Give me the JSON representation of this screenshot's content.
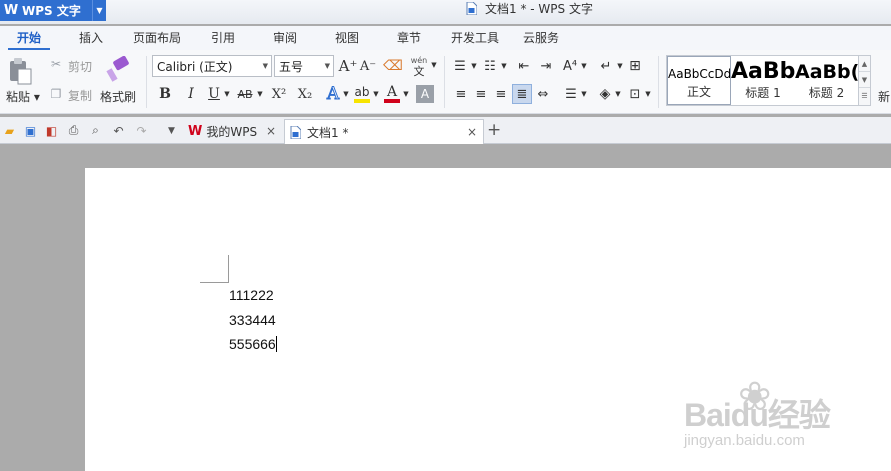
{
  "app": {
    "name": "WPS 文字",
    "logo_letter": "W"
  },
  "window": {
    "title": "文档1 * - WPS 文字"
  },
  "menu": {
    "tabs": [
      "开始",
      "插入",
      "页面布局",
      "引用",
      "审阅",
      "视图",
      "章节",
      "开发工具",
      "云服务"
    ],
    "active_tab": "开始"
  },
  "ribbon": {
    "paste": "粘贴",
    "cut": "剪切",
    "copy": "复制",
    "format_painter": "格式刷",
    "font_name": "Calibri (正文)",
    "font_size": "五号",
    "grow_font": "A⁺",
    "shrink_font": "A⁻",
    "pinyin_top": "wén",
    "pinyin_char": "文",
    "bold": "B",
    "italic": "I",
    "underline": "U",
    "strikethrough": "AB",
    "superscript": "X²",
    "subscript": "X₂",
    "font_effect": "A",
    "highlight": "ab",
    "font_color": "A",
    "char_shading": "A",
    "colors": {
      "highlight": "#f7e400",
      "font_color": "#d0021b",
      "accent": "#2f6fd0"
    }
  },
  "styles": {
    "items": [
      {
        "sample": "AaBbCcDd",
        "name": "正文"
      },
      {
        "sample": "AaBb",
        "name": "标题 1"
      },
      {
        "sample": "AaBb(",
        "name": "标题 2"
      }
    ],
    "more_label": "新"
  },
  "quick_access": {
    "icons": [
      "open-folder-icon",
      "save-icon",
      "export-pdf-icon",
      "print-icon",
      "print-preview-icon",
      "undo-icon",
      "redo-icon",
      "dropdown-icon"
    ]
  },
  "doc_tabs": [
    {
      "label": "我的WPS",
      "icon": "W",
      "active": false
    },
    {
      "label": "文档1 *",
      "active": true
    }
  ],
  "document": {
    "lines": [
      "111222",
      "333444",
      "555666"
    ]
  },
  "watermark": {
    "brand": "Baidu经验",
    "url": "jingyan.baidu.com"
  }
}
